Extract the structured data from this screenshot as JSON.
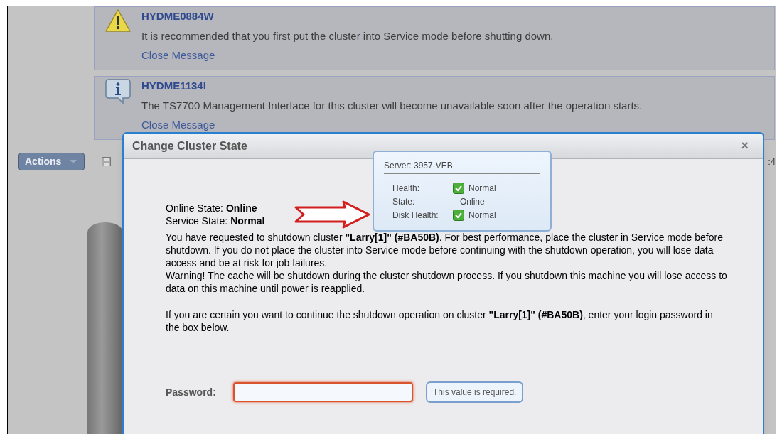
{
  "messages": [
    {
      "kind": "warning",
      "code": "HYDME0884W",
      "text": "It is recommended that you first put the cluster into Service mode before shutting down.",
      "link": "Close Message"
    },
    {
      "kind": "info",
      "code": "HYDME1134I",
      "text": "The TS7700 Management Interface for this cluster will become unavailable soon after the operation starts.",
      "link": "Close Message"
    }
  ],
  "toolbar": {
    "actions": "Actions",
    "time": ":4"
  },
  "dialog": {
    "title": "Change Cluster State",
    "close": "×",
    "states": [
      {
        "label": "Online State:",
        "value": "Online"
      },
      {
        "label": "Service State:",
        "value": "Normal"
      }
    ],
    "paragraphs": [
      "You have requested to shutdown cluster **\"Larry[1]\" (#BA50B)**. For best performance, place the cluster in Service mode before shutdown. If you do not place the cluster into Service mode before continuing with the shutdown operation, you will lose data access and be at risk for job failures.",
      "Warning! The cache will be shutdown during the cluster shutdown process. If you shutdown this machine you will lose access to data on this machine until power is reapplied.",
      "If you are certain you want to continue the shutdown operation on cluster **\"Larry[1]\" (#BA50B)**, enter your login password in the box below."
    ],
    "password": {
      "label": "Password:",
      "error": true,
      "error_text": "This value is required."
    }
  },
  "tooltip": {
    "title": "Server: 3957-VEB",
    "rows": [
      {
        "kind": "check",
        "label": "Health:",
        "value": "Normal"
      },
      {
        "kind": "plain",
        "label": "State:",
        "value": "Online"
      },
      {
        "kind": "check",
        "label": "Disk Health:",
        "value": "Normal"
      }
    ]
  }
}
